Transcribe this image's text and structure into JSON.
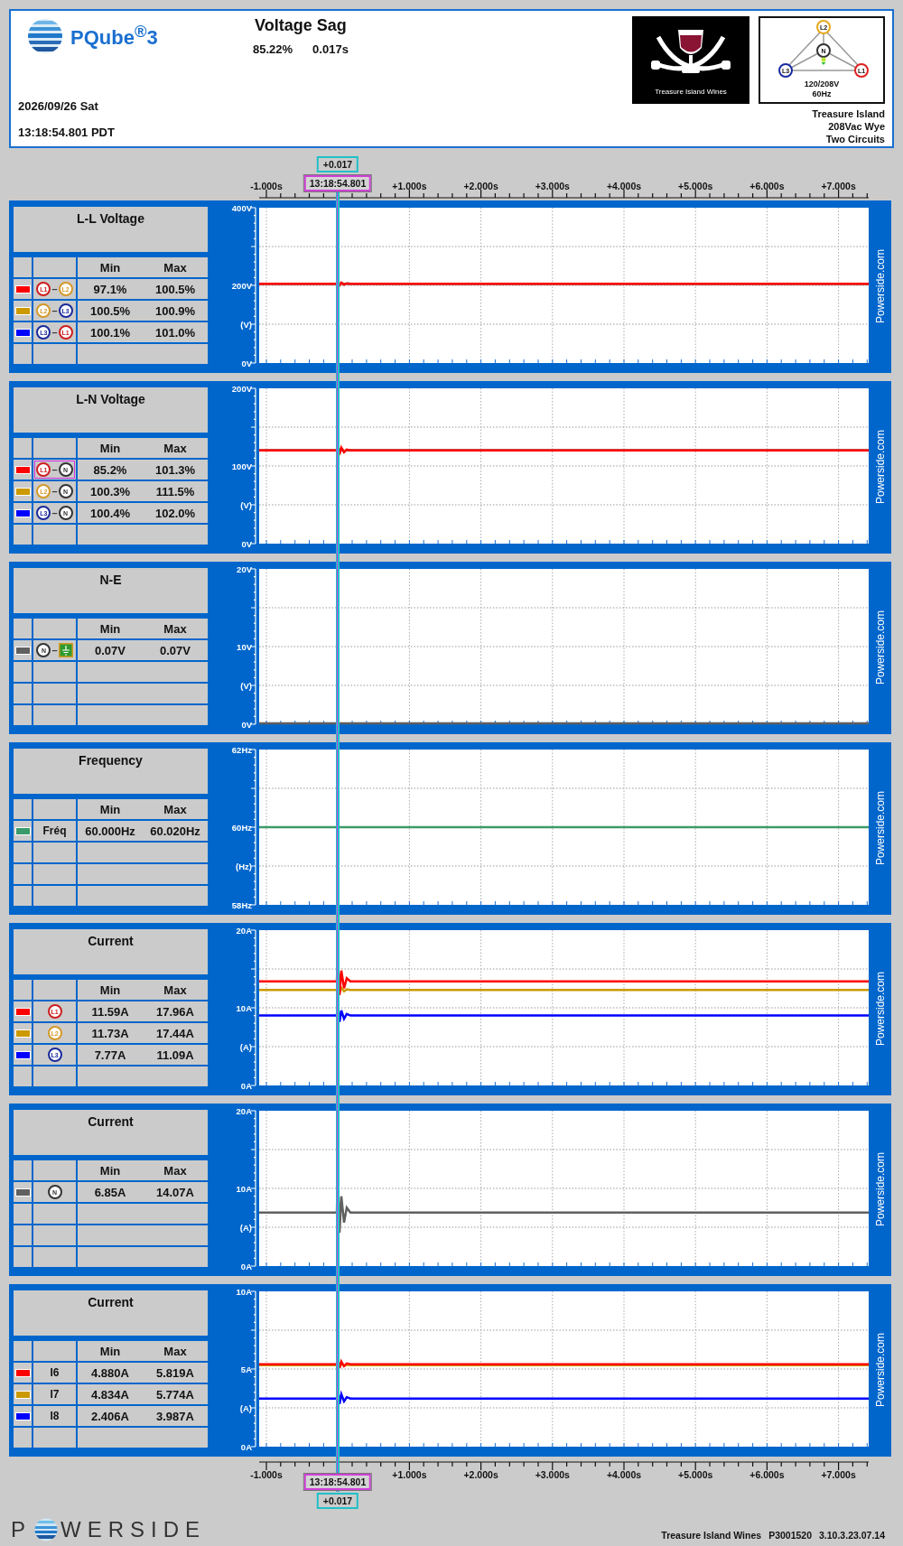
{
  "header": {
    "product": "PQube$^{®}$3",
    "event": "Voltage Sag",
    "magnitude": "85.22%",
    "duration": "0.017s",
    "date": "2026/09/26 Sat",
    "time": "13:18:54.801 PDT",
    "brand": "Treasure Island Wines",
    "wiring": {
      "phases": [
        {
          "label": "L2",
          "color": "#e8a820"
        },
        {
          "label": "N",
          "color": "#333333"
        },
        {
          "label": "L3",
          "color": "#1a2aa0"
        },
        {
          "label": "L1",
          "color": "#e02020"
        }
      ],
      "voltage": "120/208V",
      "frequency": "60Hz"
    },
    "site": [
      "Treasure Island",
      "208Vac Wye",
      "Two Circuits"
    ]
  },
  "top_axis": {
    "ticks": [
      "-1.000s",
      "+1.000s",
      "+2.000s",
      "+3.000s",
      "+4.000s",
      "+5.000s",
      "+6.000s",
      "+7.000s"
    ],
    "cursor_delta": "+0.017",
    "cursor_time": "13:18:54.801"
  },
  "panels": [
    {
      "title": "L-L Voltage",
      "columns": [
        "Min",
        "Max"
      ],
      "yticks": [
        "400V",
        "200V",
        "(V)",
        "0V"
      ],
      "side_label": "Powerside.com",
      "rows": [
        {
          "color": "#ff0000",
          "selected": false,
          "channel": [
            {
              "kind": "phase",
              "label": "L1",
              "color": "#cc1f1f"
            },
            {
              "kind": "dash",
              "label": "–"
            },
            {
              "kind": "phase",
              "label": "L2",
              "color": "#d4992a"
            }
          ],
          "min": "97.1%",
          "max": "100.5%"
        },
        {
          "color": "#cc9900",
          "selected": false,
          "channel": [
            {
              "kind": "phase",
              "label": "L2",
              "color": "#d4992a"
            },
            {
              "kind": "dash",
              "label": "–"
            },
            {
              "kind": "phase",
              "label": "L3",
              "color": "#1a2a9a"
            }
          ],
          "min": "100.5%",
          "max": "100.9%"
        },
        {
          "color": "#0000ff",
          "selected": false,
          "channel": [
            {
              "kind": "phase",
              "label": "L3",
              "color": "#1a2a9a"
            },
            {
              "kind": "dash",
              "label": "–"
            },
            {
              "kind": "phase",
              "label": "L1",
              "color": "#cc1f1f"
            }
          ],
          "min": "100.1%",
          "max": "101.0%"
        }
      ]
    },
    {
      "title": "L-N Voltage",
      "columns": [
        "Min",
        "Max"
      ],
      "yticks": [
        "200V",
        "100V",
        "(V)",
        "0V"
      ],
      "side_label": "Powerside.com",
      "rows": [
        {
          "color": "#ff0000",
          "selected": true,
          "channel": [
            {
              "kind": "phase",
              "label": "L1",
              "color": "#cc1f1f"
            },
            {
              "kind": "dash",
              "label": "–"
            },
            {
              "kind": "phase",
              "label": "N",
              "color": "#333333"
            }
          ],
          "min": "85.2%",
          "max": "101.3%"
        },
        {
          "color": "#cc9900",
          "selected": false,
          "channel": [
            {
              "kind": "phase",
              "label": "L2",
              "color": "#d4992a"
            },
            {
              "kind": "dash",
              "label": "–"
            },
            {
              "kind": "phase",
              "label": "N",
              "color": "#333333"
            }
          ],
          "min": "100.3%",
          "max": "111.5%"
        },
        {
          "color": "#0000ff",
          "selected": false,
          "channel": [
            {
              "kind": "phase",
              "label": "L3",
              "color": "#1a2a9a"
            },
            {
              "kind": "dash",
              "label": "–"
            },
            {
              "kind": "phase",
              "label": "N",
              "color": "#333333"
            }
          ],
          "min": "100.4%",
          "max": "102.0%"
        }
      ]
    },
    {
      "title": "N-E",
      "columns": [
        "Min",
        "Max"
      ],
      "yticks": [
        "20V",
        "10V",
        "(V)",
        "0V"
      ],
      "side_label": "Powerside.com",
      "rows": [
        {
          "color": "#606060",
          "selected": false,
          "channel": [
            {
              "kind": "phase",
              "label": "N",
              "color": "#333333"
            },
            {
              "kind": "dash",
              "label": "–"
            },
            {
              "kind": "ground"
            }
          ],
          "min": "0.07V",
          "max": "0.07V"
        }
      ]
    },
    {
      "title": "Frequency",
      "columns": [
        "Min",
        "Max"
      ],
      "yticks": [
        "62Hz",
        "60Hz",
        "(Hz)",
        "58Hz"
      ],
      "side_label": "Powerside.com",
      "rows": [
        {
          "color": "#3a9a6a",
          "selected": false,
          "channel": [
            {
              "kind": "text",
              "label": "Fréq"
            }
          ],
          "min": "60.000Hz",
          "max": "60.020Hz"
        }
      ]
    },
    {
      "title": "Current",
      "columns": [
        "Min",
        "Max"
      ],
      "yticks": [
        "20A",
        "10A",
        "(A)",
        "0A"
      ],
      "side_label": "Powerside.com",
      "rows": [
        {
          "color": "#ff0000",
          "selected": false,
          "channel": [
            {
              "kind": "phase",
              "label": "L1",
              "color": "#cc1f1f"
            }
          ],
          "min": "11.59A",
          "max": "17.96A"
        },
        {
          "color": "#cc9900",
          "selected": false,
          "channel": [
            {
              "kind": "phase",
              "label": "L2",
              "color": "#d4992a"
            }
          ],
          "min": "11.73A",
          "max": "17.44A"
        },
        {
          "color": "#0000ff",
          "selected": false,
          "channel": [
            {
              "kind": "phase",
              "label": "L3",
              "color": "#1a2a9a"
            }
          ],
          "min": "7.77A",
          "max": "11.09A"
        }
      ]
    },
    {
      "title": "Current",
      "columns": [
        "Min",
        "Max"
      ],
      "yticks": [
        "20A",
        "10A",
        "(A)",
        "0A"
      ],
      "side_label": "Powerside.com",
      "rows": [
        {
          "color": "#606060",
          "selected": false,
          "channel": [
            {
              "kind": "phase",
              "label": "N",
              "color": "#333333"
            }
          ],
          "min": "6.85A",
          "max": "14.07A"
        }
      ]
    },
    {
      "title": "Current",
      "columns": [
        "Min",
        "Max"
      ],
      "yticks": [
        "10A",
        "5A",
        "(A)",
        "0A"
      ],
      "side_label": "Powerside.com",
      "rows": [
        {
          "color": "#ff0000",
          "selected": false,
          "channel": [
            {
              "kind": "text",
              "label": "I6"
            }
          ],
          "min": "4.880A",
          "max": "5.819A"
        },
        {
          "color": "#cc9900",
          "selected": false,
          "channel": [
            {
              "kind": "text",
              "label": "I7"
            }
          ],
          "min": "4.834A",
          "max": "5.774A"
        },
        {
          "color": "#0000ff",
          "selected": false,
          "channel": [
            {
              "kind": "text",
              "label": "I8"
            }
          ],
          "min": "2.406A",
          "max": "3.987A"
        }
      ]
    }
  ],
  "bottom_axis": {
    "ticks": [
      "-1.000s",
      "+1.000s",
      "+2.000s",
      "+3.000s",
      "+4.000s",
      "+5.000s",
      "+6.000s",
      "+7.000s"
    ],
    "cursor_delta": "+0.017",
    "cursor_time": "13:18:54.801"
  },
  "footer": {
    "logo_before": "P",
    "logo_after": "WERSIDE",
    "site": "Treasure Island Wines",
    "serial": "P3001520",
    "version": "3.10.3.23.07.14"
  }
}
